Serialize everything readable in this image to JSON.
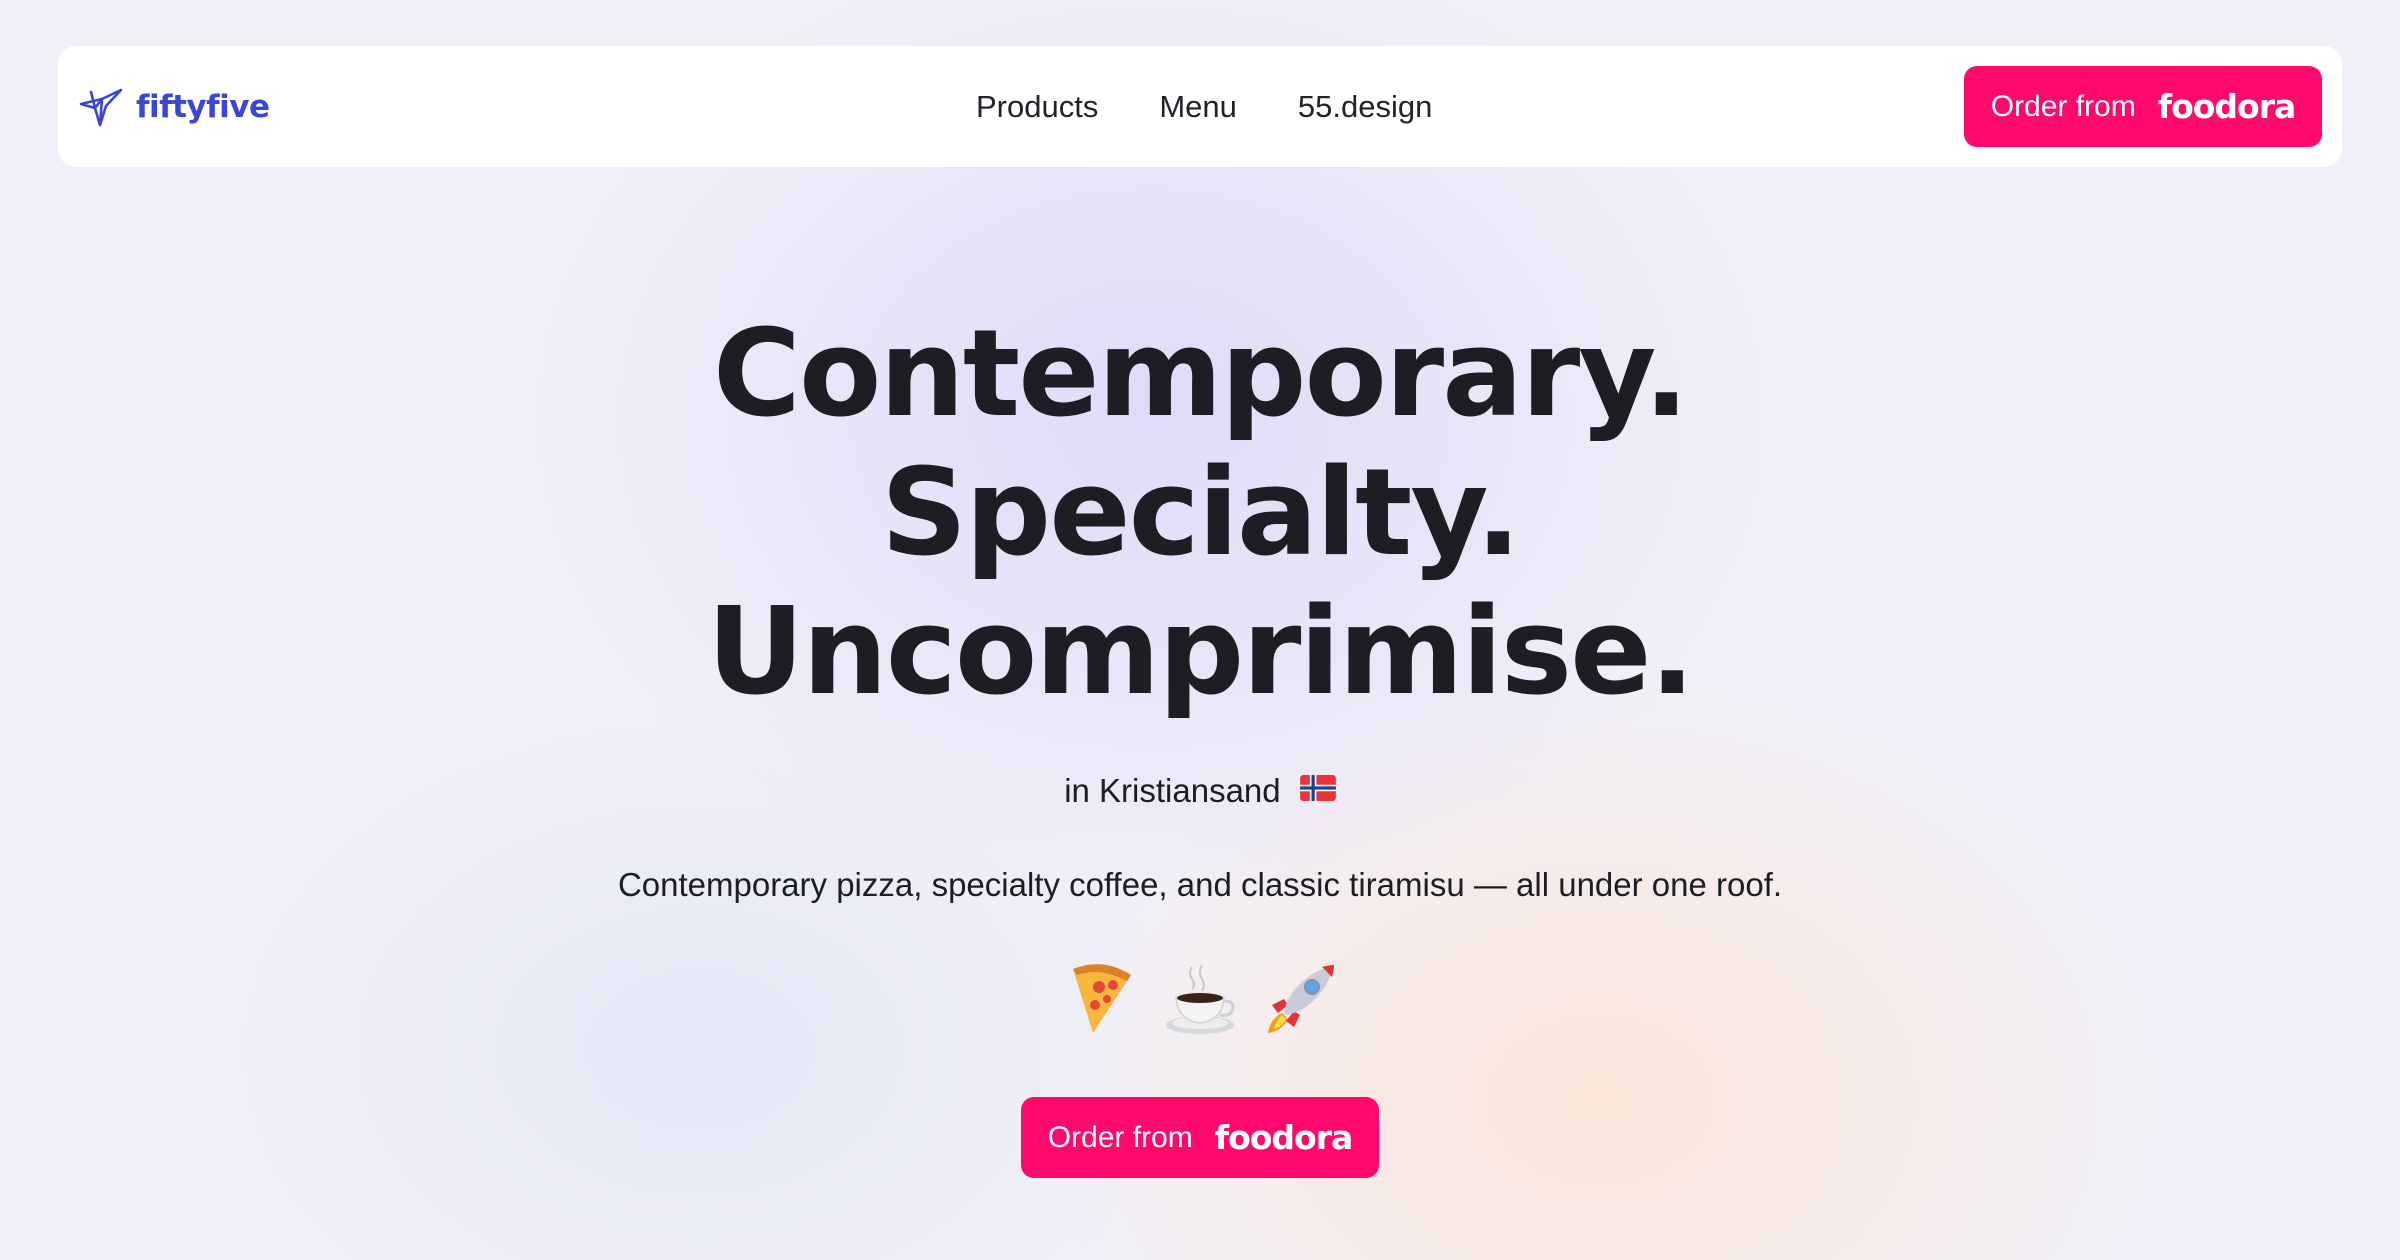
{
  "brand": {
    "name": "fiftyfive",
    "color": "#3b45d6"
  },
  "nav": {
    "links": [
      {
        "label": "Products"
      },
      {
        "label": "Menu"
      },
      {
        "label": "55.design"
      }
    ],
    "order_button": {
      "label": "Order from",
      "logo_text": "foodora"
    }
  },
  "hero": {
    "title_lines": [
      "Contemporary.",
      "Specialty.",
      "Uncomprimise."
    ],
    "location": "in Kristiansand",
    "location_flag_icon": "norway-flag-icon",
    "tagline": "Contemporary pizza, specialty coffee, and classic tiramisu — all under one roof.",
    "emojis": [
      {
        "icon": "pizza-icon",
        "char": "🍕"
      },
      {
        "icon": "coffee-icon",
        "char": "☕"
      },
      {
        "icon": "rocket-icon",
        "char": "🚀"
      }
    ],
    "order_button": {
      "label": "Order from",
      "logo_text": "foodora"
    }
  },
  "colors": {
    "accent": "#ff0a6c",
    "background": "#f1f0f8",
    "text": "#1d1d24"
  }
}
